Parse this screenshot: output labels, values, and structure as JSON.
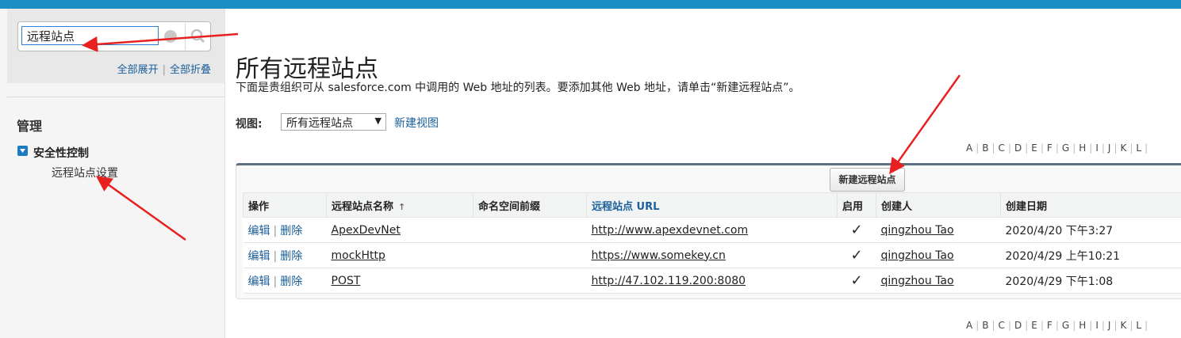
{
  "sidebar": {
    "search_value": "远程站点",
    "expand_all": "全部展开",
    "collapse_all": "全部折叠",
    "section_title": "管理",
    "security_label": "安全性控制",
    "security_item": "远程站点设置"
  },
  "main": {
    "title": "所有远程站点",
    "description": "下面是贵组织可从 salesforce.com 中调用的 Web 地址的列表。要添加其他 Web 地址，请单击“新建远程站点”。",
    "view_label": "视图:",
    "view_selected": "所有远程站点",
    "new_view": "新建视图",
    "new_site_button": "新建远程站点",
    "alphabet": [
      "A",
      "B",
      "C",
      "D",
      "E",
      "F",
      "G",
      "H",
      "I",
      "J",
      "K",
      "L"
    ]
  },
  "table": {
    "columns": [
      "操作",
      "远程站点名称",
      "命名空间前缀",
      "远程站点 URL",
      "启用",
      "创建人",
      "创建日期"
    ],
    "edit_label": "编辑",
    "delete_label": "删除",
    "check_mark": "✓",
    "rows": [
      {
        "name": "ApexDevNet",
        "prefix": "",
        "url": "http://www.apexdevnet.com",
        "active": true,
        "creator": "qingzhou Tao",
        "date": "2020/4/20 下午3:27"
      },
      {
        "name": "mockHttp",
        "prefix": "",
        "url": "https://www.somekey.cn",
        "active": true,
        "creator": "qingzhou Tao",
        "date": "2020/4/29 上午10:21"
      },
      {
        "name": "POST",
        "prefix": "",
        "url": "http://47.102.119.200:8080",
        "active": true,
        "creator": "qingzhou Tao",
        "date": "2020/4/29 下午1:08"
      }
    ]
  },
  "colors": {
    "topbar": "#1b8fc4",
    "link": "#1a5f9c",
    "annotation_arrow": "#e8201f"
  }
}
